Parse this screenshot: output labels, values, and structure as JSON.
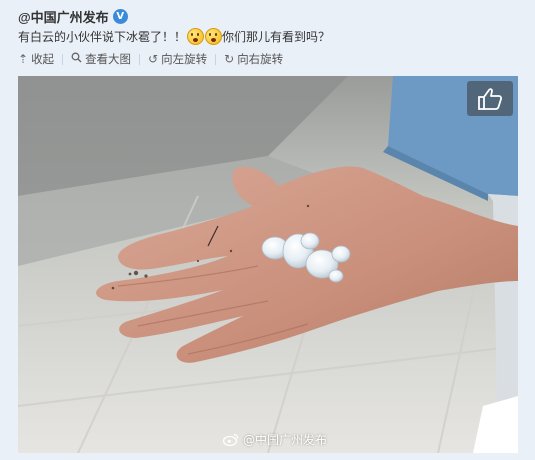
{
  "post": {
    "author": "@中国广州发布",
    "verified_badge": "V",
    "text_before_emoji": "有白云的小伙伴说下冰雹了！！",
    "text_after_emoji": "你们那儿有看到吗？",
    "emoji_icons": [
      "surprised-emoji-icon",
      "surprised-emoji-icon"
    ]
  },
  "toolbar": {
    "collapse_label": "收起",
    "view_large_label": "查看大图",
    "rotate_left_label": "向左旋转",
    "rotate_right_label": "向右旋转"
  },
  "photo": {
    "watermark": "@中国广州发布",
    "like_icon": "thumbs-up-icon"
  },
  "colors": {
    "background": "#eaf0f8",
    "verified_badge": "#3c8bd9"
  }
}
